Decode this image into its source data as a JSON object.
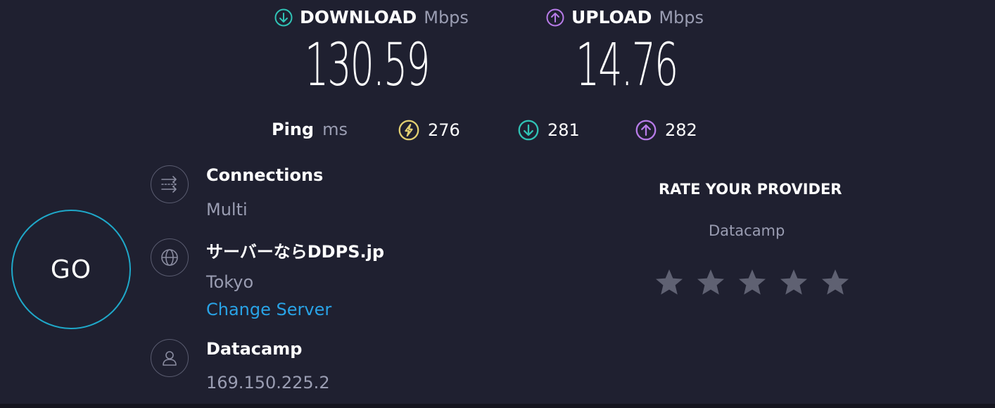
{
  "download": {
    "label": "DOWNLOAD",
    "unit": "Mbps",
    "value": "130.59",
    "icon": "arrow-down-circle-icon",
    "color": "#30c3b6"
  },
  "upload": {
    "label": "UPLOAD",
    "unit": "Mbps",
    "value": "14.76",
    "icon": "arrow-up-circle-icon",
    "color": "#b77be8"
  },
  "ping": {
    "label": "Ping",
    "unit": "ms",
    "idle": {
      "value": "276",
      "icon": "ping-bolt-icon",
      "color": "#e3d071"
    },
    "download": {
      "value": "281",
      "icon": "arrow-down-circle-icon",
      "color": "#30c3b6"
    },
    "upload": {
      "value": "282",
      "icon": "arrow-up-circle-icon",
      "color": "#b77be8"
    }
  },
  "go_button": {
    "label": "GO",
    "color": "#1fa8c9"
  },
  "connections": {
    "title": "Connections",
    "value": "Multi",
    "icon": "connections-arrows-icon"
  },
  "server": {
    "title": "サーバーならDDPS.jp",
    "location": "Tokyo",
    "change_link": "Change Server",
    "icon": "globe-icon"
  },
  "provider": {
    "title": "Datacamp",
    "ip": "169.150.225.2",
    "icon": "user-icon"
  },
  "rating": {
    "title": "RATE YOUR PROVIDER",
    "provider_name": "Datacamp",
    "star_count": 5,
    "selected": 0,
    "star_color": "#5f6172"
  },
  "colors": {
    "background": "#1f2030",
    "muted_text": "#9a9db2",
    "link": "#29a3e6"
  }
}
